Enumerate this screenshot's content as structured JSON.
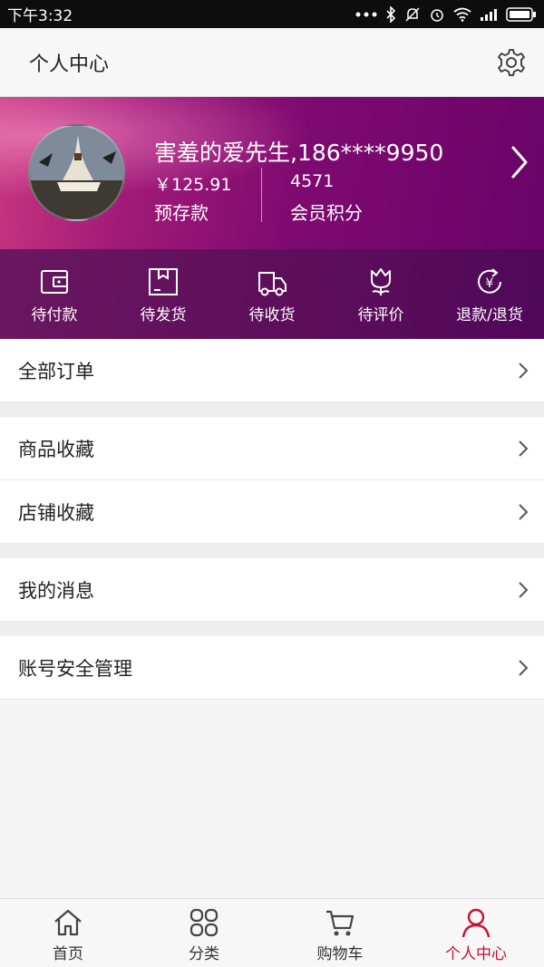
{
  "status_bar": {
    "time": "下午3:32",
    "icons": [
      "more-dots-icon",
      "bluetooth-icon",
      "mute-icon",
      "alarm-icon",
      "wifi-icon",
      "signal-icon",
      "battery-icon"
    ]
  },
  "header": {
    "title": "个人中心",
    "settings_icon": "gear-icon"
  },
  "profile": {
    "name": "害羞的爱先生,186****9950",
    "deposit_amount": "￥125.91",
    "deposit_label": "预存款",
    "points_amount": "4571",
    "points_label": "会员积分"
  },
  "order_statuses": [
    {
      "label": "待付款",
      "icon": "wallet-icon"
    },
    {
      "label": "待发货",
      "icon": "package-icon"
    },
    {
      "label": "待收货",
      "icon": "truck-icon"
    },
    {
      "label": "待评价",
      "icon": "tulip-icon"
    },
    {
      "label": "退款/退货",
      "icon": "refund-icon"
    }
  ],
  "menu": {
    "all_orders": "全部订单",
    "favorite_goods": "商品收藏",
    "favorite_shops": "店铺收藏",
    "my_messages": "我的消息",
    "account_security": "账号安全管理"
  },
  "tabs": [
    {
      "label": "首页",
      "icon": "home-icon"
    },
    {
      "label": "分类",
      "icon": "category-icon"
    },
    {
      "label": "购物车",
      "icon": "cart-icon"
    },
    {
      "label": "个人中心",
      "icon": "person-icon",
      "active": true
    }
  ],
  "colors": {
    "accent": "#c8102e",
    "profile_bg": "#7e0a70"
  }
}
